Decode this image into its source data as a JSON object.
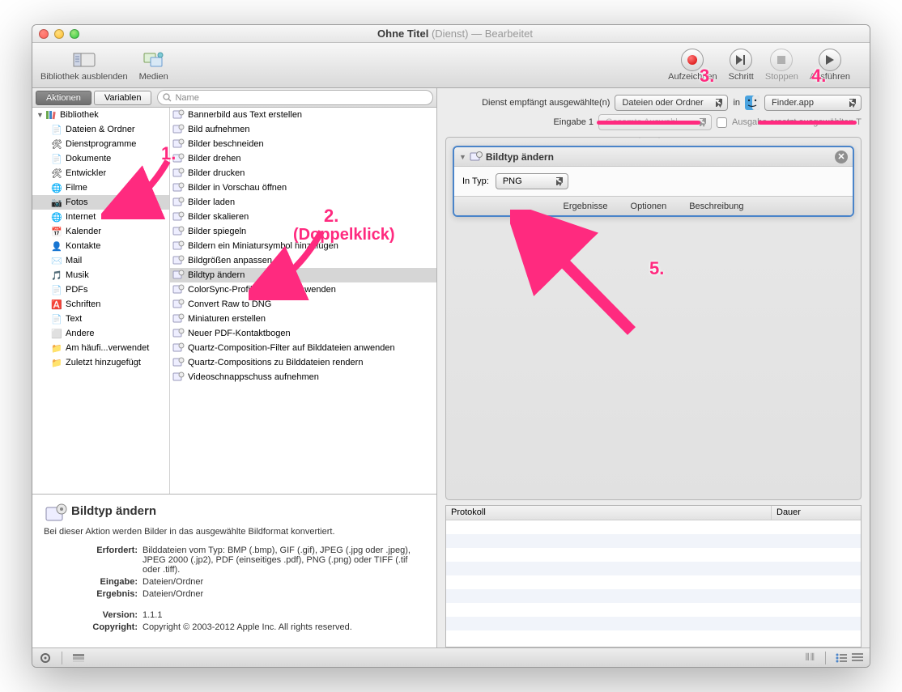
{
  "title": {
    "main": "Ohne Titel",
    "paren": "(Dienst)",
    "dash": " — ",
    "state": "Bearbeitet"
  },
  "toolbar": {
    "hide_lib": "Bibliothek ausblenden",
    "media": "Medien",
    "record": "Aufzeichnen",
    "step": "Schritt",
    "stop": "Stoppen",
    "run": "Ausführen"
  },
  "tabs": {
    "actions": "Aktionen",
    "vars": "Variablen",
    "search_ph": "Name"
  },
  "tree_root": "Bibliothek",
  "tree": [
    "Dateien & Ordner",
    "Dienstprogramme",
    "Dokumente",
    "Entwickler",
    "Filme",
    "Fotos",
    "Internet",
    "Kalender",
    "Kontakte",
    "Mail",
    "Musik",
    "PDFs",
    "Schriften",
    "Text",
    "Andere",
    "Am häufi...verwendet",
    "Zuletzt hinzugefügt"
  ],
  "tree_selected": 5,
  "actions": [
    "Bannerbild aus Text erstellen",
    "Bild aufnehmen",
    "Bilder beschneiden",
    "Bilder drehen",
    "Bilder drucken",
    "Bilder in Vorschau öffnen",
    "Bilder laden",
    "Bilder skalieren",
    "Bilder spiegeln",
    "Bildern ein Miniatursymbol hinzufügen",
    "Bildgrößen anpassen",
    "Bildtyp ändern",
    "ColorSync-Profil auf Bilder anwenden",
    "Convert Raw to DNG",
    "Miniaturen erstellen",
    "Neuer PDF-Kontaktbogen",
    "Quartz-Composition-Filter auf Bilddateien anwenden",
    "Quartz-Compositions zu Bilddateien rendern",
    "Videoschnappschuss aufnehmen"
  ],
  "action_selected": 11,
  "info": {
    "title": "Bildtyp ändern",
    "desc": "Bei dieser Aktion werden Bilder in das ausgewählte Bildformat konvertiert.",
    "k_req": "Erfordert:",
    "v_req": "Bilddateien vom Typ: BMP (.bmp), GIF (.gif), JPEG (.jpg oder .jpeg), JPEG 2000 (.jp2), PDF (einseitiges .pdf), PNG (.png) oder TIFF (.tif oder .tiff).",
    "k_in": "Eingabe:",
    "v_in": "Dateien/Ordner",
    "k_out": "Ergebnis:",
    "v_out": "Dateien/Ordner",
    "k_ver": "Version:",
    "v_ver": "1.1.1",
    "k_cop": "Copyright:",
    "v_cop": "Copyright © 2003-2012 Apple Inc.  All rights reserved."
  },
  "svc": {
    "receives": "Dienst empfängt ausgewählte(n)",
    "type": "Dateien oder Ordner",
    "in": "in",
    "app": "Finder.app",
    "input1": "Eingabe 1",
    "whole": "Gesamte Auswahl",
    "replaces": "Ausgabe ersetzt ausgewählten T"
  },
  "card": {
    "title": "Bildtyp ändern",
    "to_label": "In Typ:",
    "to_value": "PNG",
    "t1": "Ergebnisse",
    "t2": "Optionen",
    "t3": "Beschreibung"
  },
  "log": {
    "c1": "Protokoll",
    "c2": "Dauer"
  },
  "annot": {
    "a1": "1.",
    "a2": "2.",
    "a2b": "(Doppelklick)",
    "a3": "3.",
    "a4": "4.",
    "a5": "5."
  }
}
